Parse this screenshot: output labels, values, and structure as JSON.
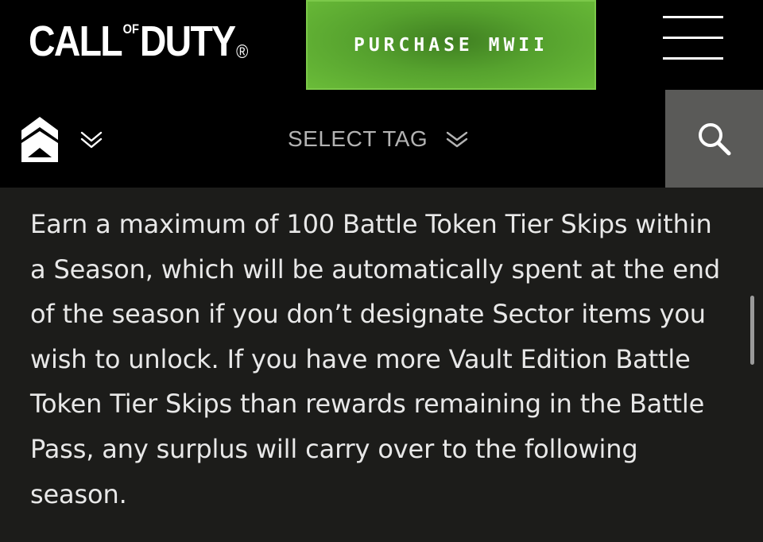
{
  "header": {
    "logo": {
      "call": "CALL",
      "of": "OF",
      "duty": "DUTY",
      "registered": "®"
    },
    "purchase_label": "PURCHASE MWII",
    "menu_icon": "hamburger-menu-icon"
  },
  "subnav": {
    "rank_icon": "rank-chevron-icon",
    "rank_dropdown_icon": "double-chevron-down-icon",
    "select_tag_label": "SELECT TAG",
    "select_tag_icon": "double-chevron-down-icon",
    "search_icon": "search-icon"
  },
  "article": {
    "paragraph": "Earn a maximum of 100 Battle Token Tier Skips within a Season, which will be automatically spent at the end of the season if you don’t designate Sector items you wish to unlock. If you have more Vault Edition Battle Token Tier Skips than rewards remaining in the Battle Pass, any surplus will carry over to the following season."
  },
  "colors": {
    "background": "#000000",
    "content_background": "#1c1c1a",
    "purchase_green": "#56a22e",
    "search_button": "#5a5a58",
    "text": "#e8e8e8",
    "muted_text": "#b3b3b3"
  }
}
